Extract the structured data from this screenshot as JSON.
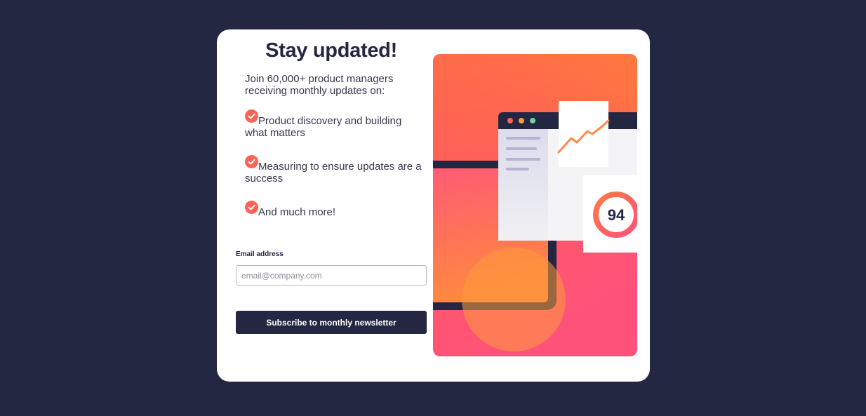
{
  "signup": {
    "title": "Stay updated!",
    "intro": "Join 60,000+ product managers receiving monthly updates on:",
    "features": [
      "Product discovery and building what matters",
      "Measuring to ensure updates are a success",
      "And much more!"
    ],
    "email_label": "Email address",
    "email_placeholder": "email@company.com",
    "email_value": "",
    "subscribe_label": "Subscribe to monthly newsletter"
  },
  "illustration": {
    "score": "94"
  },
  "colors": {
    "background": "#242742",
    "card": "#ffffff",
    "accent": "#ff6257",
    "accent_orange": "#ff8f3f",
    "accent_pink": "#ff527b",
    "window_dot_green": "#6ed3a0"
  }
}
